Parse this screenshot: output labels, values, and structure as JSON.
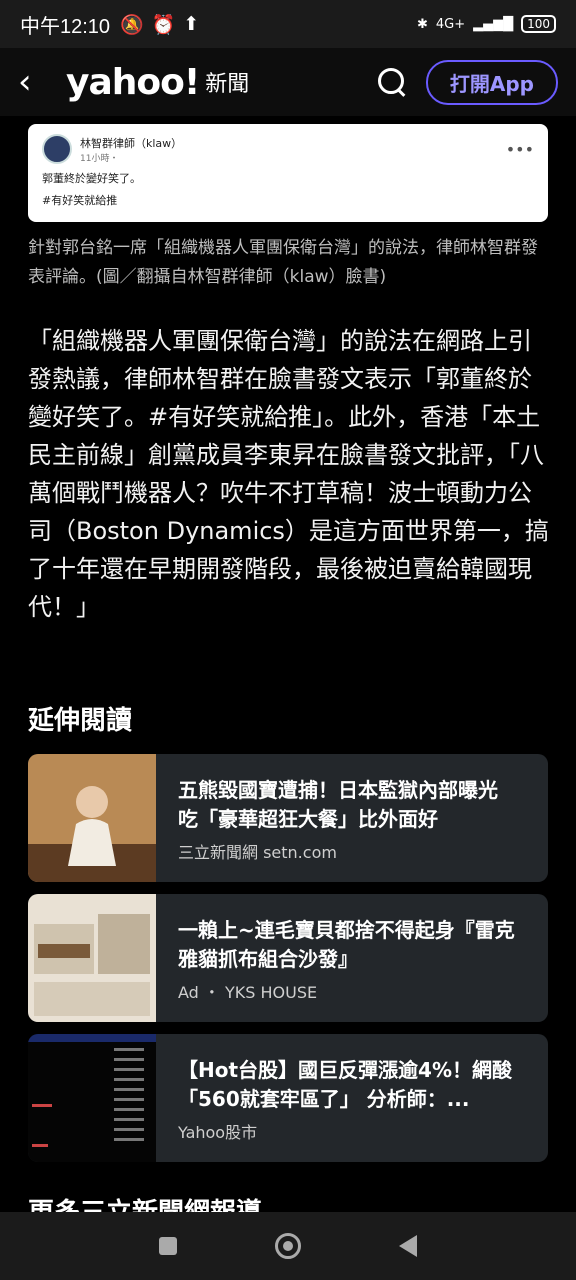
{
  "status": {
    "time": "中午12:10",
    "net": "4G+",
    "battery": "100"
  },
  "appbar": {
    "logo": "yahoo!",
    "logo_sub": "新聞",
    "open_app": "打開App"
  },
  "fb_post": {
    "author": "林智群律師（klaw）",
    "time": "11小時・",
    "line1": "郭董終於變好笑了。",
    "line2": "#有好笑就給推"
  },
  "caption": "針對郭台銘一席「組織機器人軍團保衛台灣」的說法，律師林智群發表評論。(圖／翻攝自林智群律師（klaw）臉書)",
  "body": "「組織機器人軍團保衛台灣」的說法在網路上引發熱議，律師林智群在臉書發文表示「郭董終於變好笑了。#有好笑就給推」。此外，香港「本土民主前線」創黨成員李東昇在臉書發文批評，「八萬個戰鬥機器人？吹牛不打草稿！波士頓動力公司（Boston Dynamics）是這方面世界第一，搞了十年還在早期開發階段，最後被迫賣給韓國現代！」",
  "section_title": "延伸閱讀",
  "related": [
    {
      "title": "五熊毀國寶遭捕！日本監獄內部曝光　吃「豪華超狂大餐」比外面好",
      "source": "三立新聞網 setn.com"
    },
    {
      "title": "一賴上~連毛寶貝都捨不得起身『雷克雅貓抓布組合沙發』",
      "source": "Ad ・ YKS HOUSE"
    },
    {
      "title": "【Hot台股】國巨反彈漲逾4%！網酸「560就套牢區了」 分析師：...",
      "source": "Yahoo股市"
    }
  ],
  "more_title": "更多三立新聞網報導"
}
